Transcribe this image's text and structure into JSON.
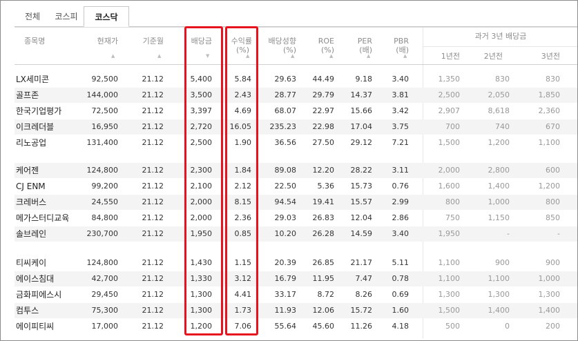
{
  "tabs": [
    "전체",
    "코스피",
    "코스닥"
  ],
  "active_tab": "코스닥",
  "headers": {
    "name": "종목명",
    "price": "현재가",
    "base_month": "기준월",
    "dividend": "배당금",
    "yield_l1": "수익률",
    "yield_l2": "(%)",
    "payout_l1": "배당성향",
    "payout_l2": "(%)",
    "roe_l1": "ROE",
    "roe_l2": "(%)",
    "per_l1": "PER",
    "per_l2": "(배)",
    "pbr_l1": "PBR",
    "pbr_l2": "(배)",
    "past_group": "과거 3년 배당금",
    "past1": "1년전",
    "past2": "2년전",
    "past3": "3년전"
  },
  "sort_arrow": "▲",
  "sort_arrow_active": "▼",
  "rows": [
    {
      "name": "LX세미콘",
      "price": "92,500",
      "month": "21.12",
      "div": "5,400",
      "yield": "5.84",
      "payout": "29.63",
      "roe": "44.49",
      "per": "9.18",
      "pbr": "3.40",
      "p1": "1,350",
      "p2": "830",
      "p3": "830"
    },
    {
      "name": "골프존",
      "price": "144,000",
      "month": "21.12",
      "div": "3,500",
      "yield": "2.43",
      "payout": "28.77",
      "roe": "29.79",
      "per": "14.37",
      "pbr": "3.81",
      "p1": "2,500",
      "p2": "2,050",
      "p3": "1,850"
    },
    {
      "name": "한국기업평가",
      "price": "72,500",
      "month": "21.12",
      "div": "3,397",
      "yield": "4.69",
      "payout": "68.07",
      "roe": "22.97",
      "per": "15.66",
      "pbr": "3.42",
      "p1": "2,907",
      "p2": "8,618",
      "p3": "2,360"
    },
    {
      "name": "이크레더블",
      "price": "16,950",
      "month": "21.12",
      "div": "2,720",
      "yield": "16.05",
      "payout": "235.23",
      "roe": "22.98",
      "per": "17.04",
      "pbr": "3.75",
      "p1": "700",
      "p2": "740",
      "p3": "670"
    },
    {
      "name": "리노공업",
      "price": "131,400",
      "month": "21.12",
      "div": "2,500",
      "yield": "1.90",
      "payout": "36.56",
      "roe": "27.50",
      "per": "29.12",
      "pbr": "7.21",
      "p1": "1,500",
      "p2": "1,200",
      "p3": "1,100"
    },
    {
      "name": "케어젠",
      "price": "124,800",
      "month": "21.12",
      "div": "2,300",
      "yield": "1.84",
      "payout": "89.08",
      "roe": "12.20",
      "per": "28.22",
      "pbr": "3.11",
      "p1": "2,000",
      "p2": "2,800",
      "p3": "600"
    },
    {
      "name": "CJ ENM",
      "price": "99,200",
      "month": "21.12",
      "div": "2,100",
      "yield": "2.12",
      "payout": "22.50",
      "roe": "5.36",
      "per": "15.73",
      "pbr": "0.76",
      "p1": "1,600",
      "p2": "1,400",
      "p3": "1,200"
    },
    {
      "name": "크레버스",
      "price": "24,550",
      "month": "21.12",
      "div": "2,000",
      "yield": "8.15",
      "payout": "94.54",
      "roe": "19.41",
      "per": "15.57",
      "pbr": "2.99",
      "p1": "800",
      "p2": "1,000",
      "p3": "800"
    },
    {
      "name": "메가스터디교육",
      "price": "84,800",
      "month": "21.12",
      "div": "2,000",
      "yield": "2.36",
      "payout": "29.03",
      "roe": "26.83",
      "per": "12.04",
      "pbr": "2.86",
      "p1": "750",
      "p2": "1,150",
      "p3": "850"
    },
    {
      "name": "솔브레인",
      "price": "230,700",
      "month": "21.12",
      "div": "1,950",
      "yield": "0.85",
      "payout": "10.20",
      "roe": "26.28",
      "per": "14.59",
      "pbr": "3.40",
      "p1": "1,950",
      "p2": "-",
      "p3": "-"
    },
    {
      "name": "티씨케이",
      "price": "124,800",
      "month": "21.12",
      "div": "1,430",
      "yield": "1.15",
      "payout": "20.39",
      "roe": "26.85",
      "per": "21.17",
      "pbr": "5.11",
      "p1": "1,100",
      "p2": "900",
      "p3": "900"
    },
    {
      "name": "에이스침대",
      "price": "42,700",
      "month": "21.12",
      "div": "1,330",
      "yield": "3.12",
      "payout": "16.79",
      "roe": "11.95",
      "per": "7.47",
      "pbr": "0.78",
      "p1": "1,100",
      "p2": "1,100",
      "p3": "1,000"
    },
    {
      "name": "금화피에스시",
      "price": "29,450",
      "month": "21.12",
      "div": "1,300",
      "yield": "4.41",
      "payout": "33.17",
      "roe": "8.72",
      "per": "8.26",
      "pbr": "0.69",
      "p1": "1,300",
      "p2": "1,300",
      "p3": "1,300"
    },
    {
      "name": "컴투스",
      "price": "75,300",
      "month": "21.12",
      "div": "1,300",
      "yield": "1.73",
      "payout": "11.93",
      "roe": "12.06",
      "per": "15.72",
      "pbr": "1.60",
      "p1": "1,500",
      "p2": "1,400",
      "p3": "1,400"
    },
    {
      "name": "에이피티씨",
      "price": "17,000",
      "month": "21.12",
      "div": "1,200",
      "yield": "7.06",
      "payout": "55.64",
      "roe": "45.60",
      "per": "11.26",
      "pbr": "4.18",
      "p1": "500",
      "p2": "0",
      "p3": "200"
    }
  ]
}
